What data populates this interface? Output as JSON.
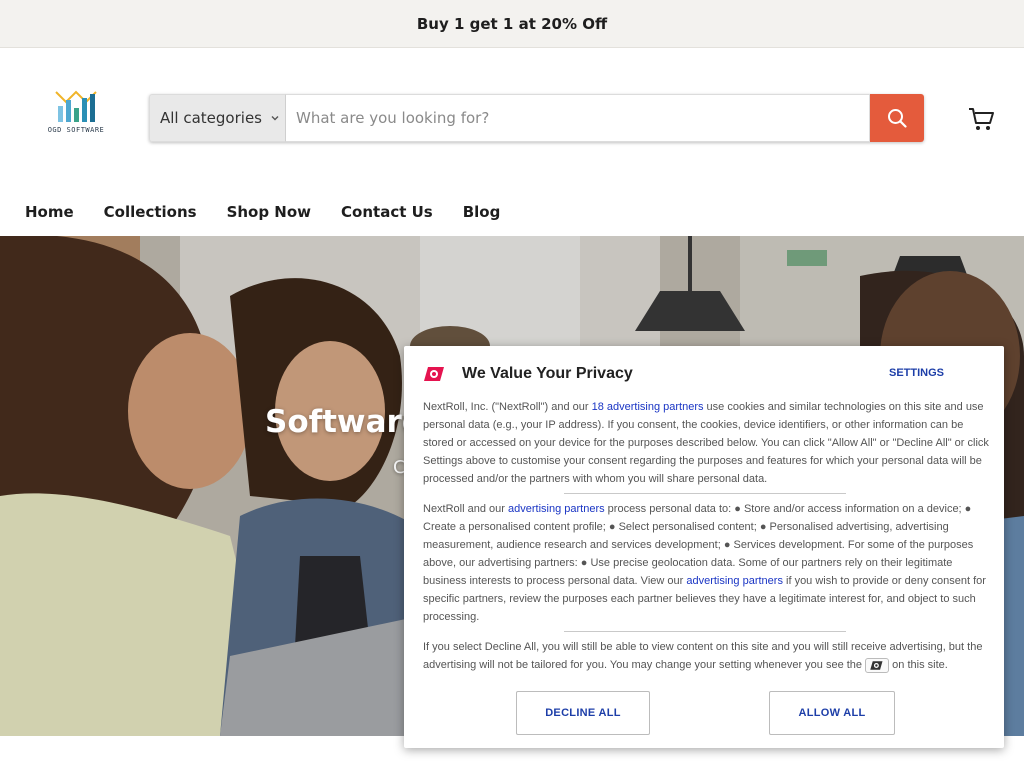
{
  "announcement": {
    "text": "Buy 1 get 1 at 20% Off"
  },
  "header": {
    "logo_text": "OGD SOFTWARE",
    "logo_icon": "bar-chart-logo",
    "search": {
      "category_label": "All categories",
      "placeholder": "What are you looking for?",
      "button_icon": "search-icon"
    },
    "cart_icon": "cart-icon"
  },
  "nav": {
    "items": [
      {
        "label": "Home"
      },
      {
        "label": "Collections"
      },
      {
        "label": "Shop Now"
      },
      {
        "label": "Contact Us"
      },
      {
        "label": "Blog"
      }
    ]
  },
  "hero": {
    "title_partial": "Software",
    "subtitle_partial": "C"
  },
  "consent": {
    "title": "We Value Your Privacy",
    "settings_label": "SETTINGS",
    "p1_a": "NextRoll, Inc. (\"NextRoll\") and our ",
    "p1_link": "18 advertising partners",
    "p1_b": " use cookies and similar technologies on this site and use personal data (e.g., your IP address). If you consent, the cookies, device identifiers, or other information can be stored or accessed on your device for the purposes described below. You can click \"Allow All\" or \"Decline All\" or click Settings above to customise your consent regarding the purposes and features for which your personal data will be processed and/or the partners with whom you will share personal data.",
    "p2_a": "NextRoll and our ",
    "p2_link1": "advertising partners",
    "p2_b": " process personal data to: ● Store and/or access information on a device; ● Create a personalised content profile; ● Select personalised content; ● Personalised advertising, advertising measurement, audience research and services development; ● Services development. For some of the purposes above, our advertising partners: ● Use precise geolocation data. Some of our partners rely on their legitimate business interests to process personal data. View our ",
    "p2_link2": "advertising partners",
    "p2_c": " if you wish to provide or deny consent for specific partners, review the purposes each partner believes they have a legitimate interest for, and object to such processing.",
    "p3_a": "If you select Decline All, you will still be able to view content on this site and you will still receive advertising, but the advertising will not be tailored for you. You may change your setting whenever you see the ",
    "p3_b": " on this site.",
    "decline_label": "DECLINE ALL",
    "allow_label": "ALLOW ALL"
  },
  "colors": {
    "accent": "#e45b3c",
    "link": "#1a35c4",
    "announcement_bg": "#f3f2ef",
    "consent_brand": "#e5134f"
  }
}
